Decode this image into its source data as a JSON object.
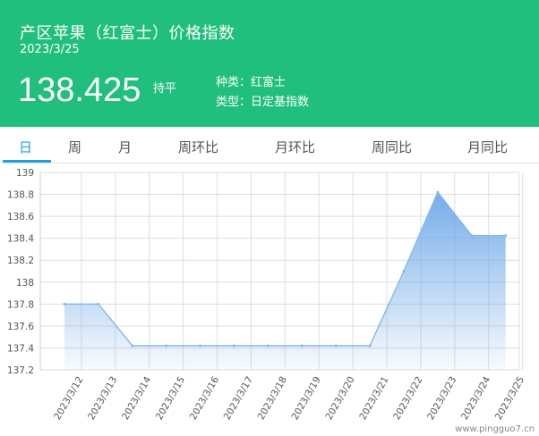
{
  "header": {
    "title": "产区苹果（红富士）价格指数",
    "date": "2023/3/25",
    "price": "138.425",
    "change": "持平",
    "variety": "种类：红富士",
    "type": "类型：日定基指数",
    "colors": {
      "background": "#20bf7d",
      "text": "#ffffff"
    }
  },
  "tabs": [
    "日",
    "周",
    "月",
    "周环比",
    "月环比",
    "周同比",
    "月同比"
  ],
  "active_tab": "日",
  "watermark": "www.pingguo7.cn",
  "chart_data": {
    "type": "area",
    "x": [
      "2023/3/12",
      "2023/3/13",
      "2023/3/14",
      "2023/3/15",
      "2023/3/16",
      "2023/3/17",
      "2023/3/18",
      "2023/3/19",
      "2023/3/20",
      "2023/3/21",
      "2023/3/22",
      "2023/3/23",
      "2023/3/24",
      "2023/3/25"
    ],
    "y": [
      137.8,
      137.8,
      137.42,
      137.42,
      137.42,
      137.42,
      137.42,
      137.42,
      137.42,
      137.42,
      138.1,
      138.82,
      138.425,
      138.425
    ],
    "yticks": [
      "139",
      "138.8",
      "138.6",
      "138.4",
      "138.2",
      "138",
      "137.8",
      "137.6",
      "137.4",
      "137.2"
    ],
    "ylim": [
      137.2,
      139
    ],
    "grid": true,
    "line_color": "#86bbea",
    "fill_color": "#6fa8e8"
  }
}
